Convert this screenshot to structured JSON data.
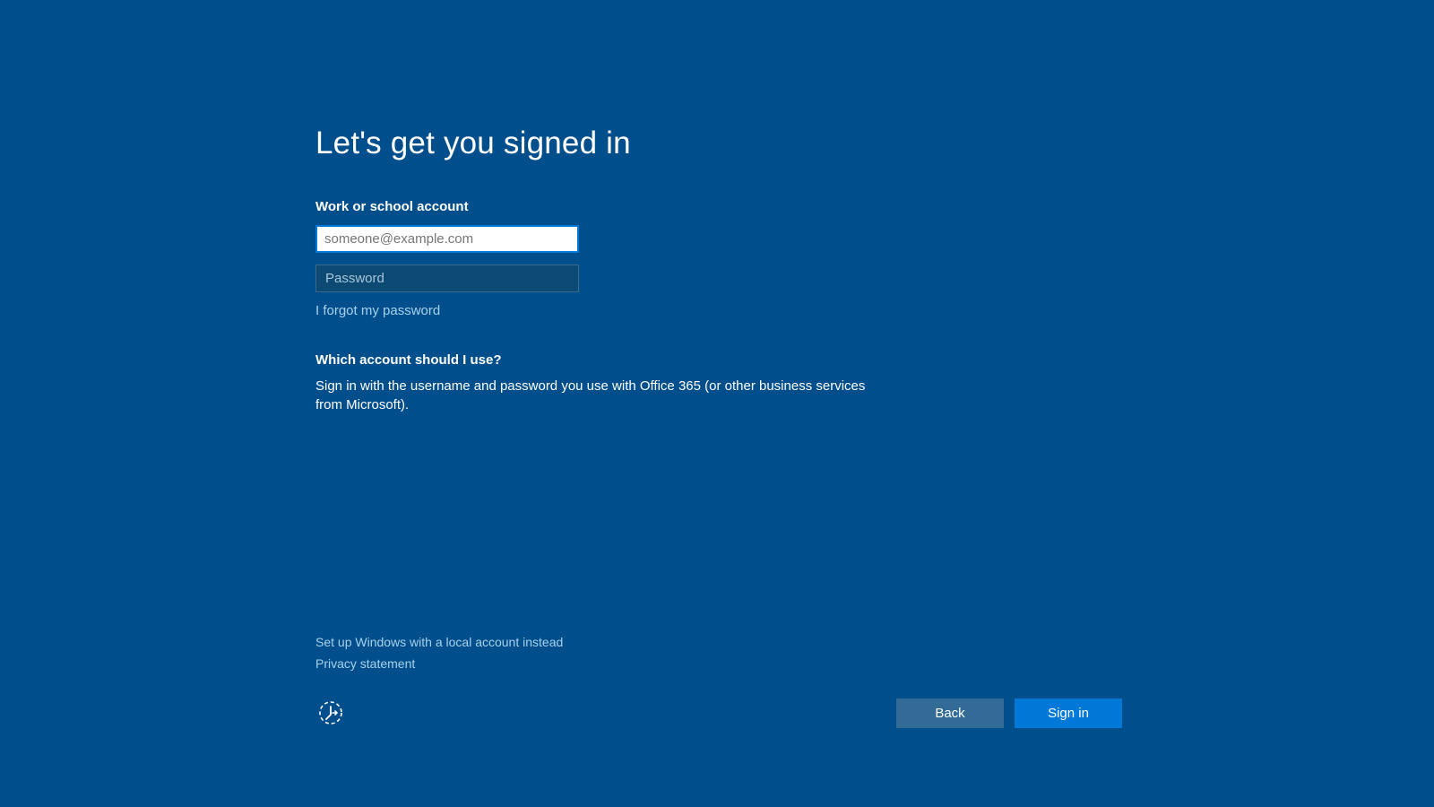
{
  "heading": "Let's get you signed in",
  "account": {
    "label": "Work or school account",
    "email_placeholder": "someone@example.com",
    "email_value": "",
    "password_placeholder": "Password",
    "password_value": "",
    "forgot_link": "I forgot my password"
  },
  "help": {
    "heading": "Which account should I use?",
    "body": "Sign in with the username and password you use with Office 365 (or other business services from Microsoft)."
  },
  "footer": {
    "local_account_link": "Set up Windows with a local account instead",
    "privacy_link": "Privacy statement",
    "ease_of_access_tooltip": "Ease of access"
  },
  "buttons": {
    "back": "Back",
    "signin": "Sign in"
  }
}
